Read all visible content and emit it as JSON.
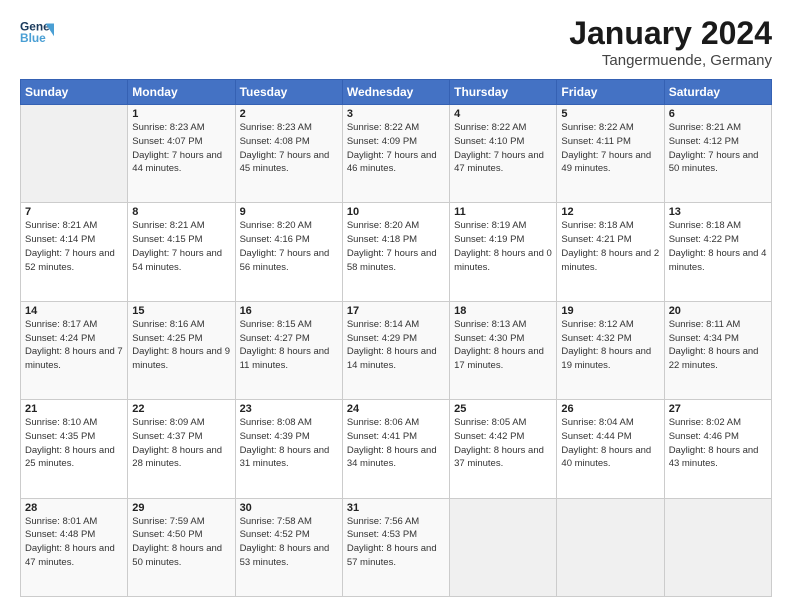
{
  "header": {
    "logo_general": "General",
    "logo_blue": "Blue",
    "title": "January 2024",
    "subtitle": "Tangermuende, Germany"
  },
  "days_of_week": [
    "Sunday",
    "Monday",
    "Tuesday",
    "Wednesday",
    "Thursday",
    "Friday",
    "Saturday"
  ],
  "weeks": [
    [
      {
        "num": "",
        "sunrise": "",
        "sunset": "",
        "daylight": ""
      },
      {
        "num": "1",
        "sunrise": "Sunrise: 8:23 AM",
        "sunset": "Sunset: 4:07 PM",
        "daylight": "Daylight: 7 hours and 44 minutes."
      },
      {
        "num": "2",
        "sunrise": "Sunrise: 8:23 AM",
        "sunset": "Sunset: 4:08 PM",
        "daylight": "Daylight: 7 hours and 45 minutes."
      },
      {
        "num": "3",
        "sunrise": "Sunrise: 8:22 AM",
        "sunset": "Sunset: 4:09 PM",
        "daylight": "Daylight: 7 hours and 46 minutes."
      },
      {
        "num": "4",
        "sunrise": "Sunrise: 8:22 AM",
        "sunset": "Sunset: 4:10 PM",
        "daylight": "Daylight: 7 hours and 47 minutes."
      },
      {
        "num": "5",
        "sunrise": "Sunrise: 8:22 AM",
        "sunset": "Sunset: 4:11 PM",
        "daylight": "Daylight: 7 hours and 49 minutes."
      },
      {
        "num": "6",
        "sunrise": "Sunrise: 8:21 AM",
        "sunset": "Sunset: 4:12 PM",
        "daylight": "Daylight: 7 hours and 50 minutes."
      }
    ],
    [
      {
        "num": "7",
        "sunrise": "Sunrise: 8:21 AM",
        "sunset": "Sunset: 4:14 PM",
        "daylight": "Daylight: 7 hours and 52 minutes."
      },
      {
        "num": "8",
        "sunrise": "Sunrise: 8:21 AM",
        "sunset": "Sunset: 4:15 PM",
        "daylight": "Daylight: 7 hours and 54 minutes."
      },
      {
        "num": "9",
        "sunrise": "Sunrise: 8:20 AM",
        "sunset": "Sunset: 4:16 PM",
        "daylight": "Daylight: 7 hours and 56 minutes."
      },
      {
        "num": "10",
        "sunrise": "Sunrise: 8:20 AM",
        "sunset": "Sunset: 4:18 PM",
        "daylight": "Daylight: 7 hours and 58 minutes."
      },
      {
        "num": "11",
        "sunrise": "Sunrise: 8:19 AM",
        "sunset": "Sunset: 4:19 PM",
        "daylight": "Daylight: 8 hours and 0 minutes."
      },
      {
        "num": "12",
        "sunrise": "Sunrise: 8:18 AM",
        "sunset": "Sunset: 4:21 PM",
        "daylight": "Daylight: 8 hours and 2 minutes."
      },
      {
        "num": "13",
        "sunrise": "Sunrise: 8:18 AM",
        "sunset": "Sunset: 4:22 PM",
        "daylight": "Daylight: 8 hours and 4 minutes."
      }
    ],
    [
      {
        "num": "14",
        "sunrise": "Sunrise: 8:17 AM",
        "sunset": "Sunset: 4:24 PM",
        "daylight": "Daylight: 8 hours and 7 minutes."
      },
      {
        "num": "15",
        "sunrise": "Sunrise: 8:16 AM",
        "sunset": "Sunset: 4:25 PM",
        "daylight": "Daylight: 8 hours and 9 minutes."
      },
      {
        "num": "16",
        "sunrise": "Sunrise: 8:15 AM",
        "sunset": "Sunset: 4:27 PM",
        "daylight": "Daylight: 8 hours and 11 minutes."
      },
      {
        "num": "17",
        "sunrise": "Sunrise: 8:14 AM",
        "sunset": "Sunset: 4:29 PM",
        "daylight": "Daylight: 8 hours and 14 minutes."
      },
      {
        "num": "18",
        "sunrise": "Sunrise: 8:13 AM",
        "sunset": "Sunset: 4:30 PM",
        "daylight": "Daylight: 8 hours and 17 minutes."
      },
      {
        "num": "19",
        "sunrise": "Sunrise: 8:12 AM",
        "sunset": "Sunset: 4:32 PM",
        "daylight": "Daylight: 8 hours and 19 minutes."
      },
      {
        "num": "20",
        "sunrise": "Sunrise: 8:11 AM",
        "sunset": "Sunset: 4:34 PM",
        "daylight": "Daylight: 8 hours and 22 minutes."
      }
    ],
    [
      {
        "num": "21",
        "sunrise": "Sunrise: 8:10 AM",
        "sunset": "Sunset: 4:35 PM",
        "daylight": "Daylight: 8 hours and 25 minutes."
      },
      {
        "num": "22",
        "sunrise": "Sunrise: 8:09 AM",
        "sunset": "Sunset: 4:37 PM",
        "daylight": "Daylight: 8 hours and 28 minutes."
      },
      {
        "num": "23",
        "sunrise": "Sunrise: 8:08 AM",
        "sunset": "Sunset: 4:39 PM",
        "daylight": "Daylight: 8 hours and 31 minutes."
      },
      {
        "num": "24",
        "sunrise": "Sunrise: 8:06 AM",
        "sunset": "Sunset: 4:41 PM",
        "daylight": "Daylight: 8 hours and 34 minutes."
      },
      {
        "num": "25",
        "sunrise": "Sunrise: 8:05 AM",
        "sunset": "Sunset: 4:42 PM",
        "daylight": "Daylight: 8 hours and 37 minutes."
      },
      {
        "num": "26",
        "sunrise": "Sunrise: 8:04 AM",
        "sunset": "Sunset: 4:44 PM",
        "daylight": "Daylight: 8 hours and 40 minutes."
      },
      {
        "num": "27",
        "sunrise": "Sunrise: 8:02 AM",
        "sunset": "Sunset: 4:46 PM",
        "daylight": "Daylight: 8 hours and 43 minutes."
      }
    ],
    [
      {
        "num": "28",
        "sunrise": "Sunrise: 8:01 AM",
        "sunset": "Sunset: 4:48 PM",
        "daylight": "Daylight: 8 hours and 47 minutes."
      },
      {
        "num": "29",
        "sunrise": "Sunrise: 7:59 AM",
        "sunset": "Sunset: 4:50 PM",
        "daylight": "Daylight: 8 hours and 50 minutes."
      },
      {
        "num": "30",
        "sunrise": "Sunrise: 7:58 AM",
        "sunset": "Sunset: 4:52 PM",
        "daylight": "Daylight: 8 hours and 53 minutes."
      },
      {
        "num": "31",
        "sunrise": "Sunrise: 7:56 AM",
        "sunset": "Sunset: 4:53 PM",
        "daylight": "Daylight: 8 hours and 57 minutes."
      },
      {
        "num": "",
        "sunrise": "",
        "sunset": "",
        "daylight": ""
      },
      {
        "num": "",
        "sunrise": "",
        "sunset": "",
        "daylight": ""
      },
      {
        "num": "",
        "sunrise": "",
        "sunset": "",
        "daylight": ""
      }
    ]
  ]
}
